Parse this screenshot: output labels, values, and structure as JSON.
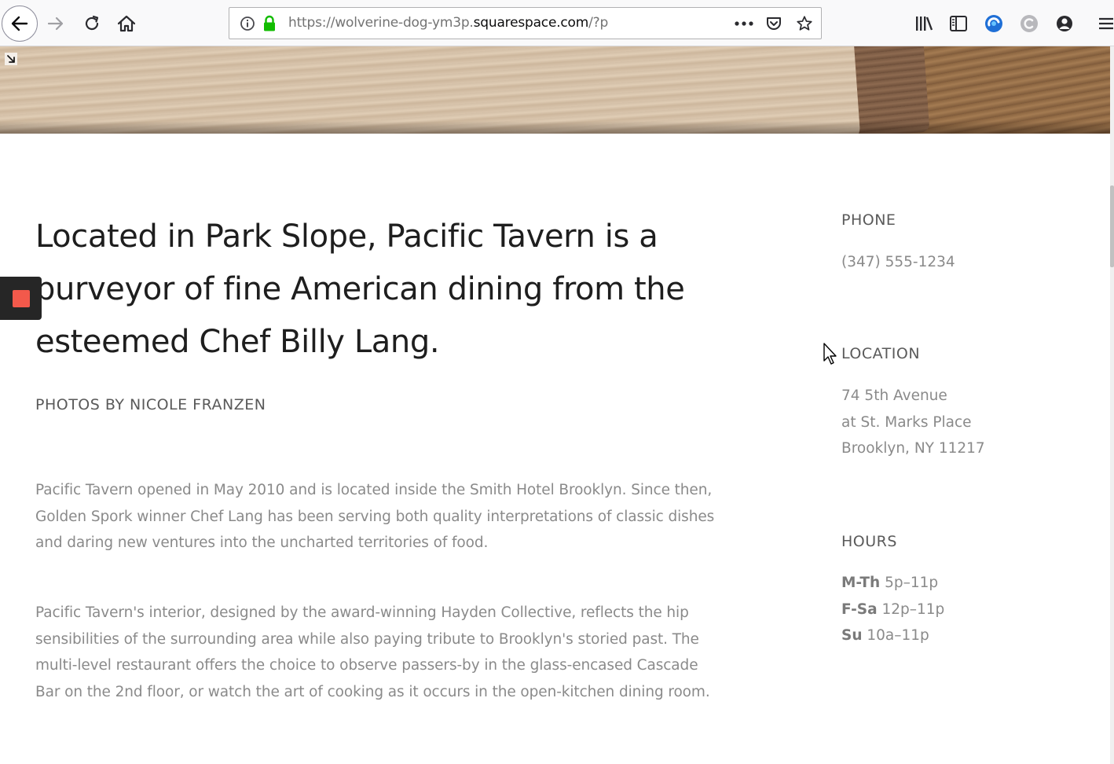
{
  "browser": {
    "url_prefix": "https://wolverine-dog-ym3p.",
    "url_domain": "squarespace.com",
    "url_suffix": "/?p",
    "icons": {
      "back": "back-arrow-icon",
      "forward": "forward-arrow-icon",
      "reload": "reload-icon",
      "home": "home-icon",
      "info": "info-icon",
      "lock": "lock-icon",
      "more": "more-dots-icon",
      "pocket": "pocket-icon",
      "bookmark": "star-icon",
      "library": "library-icon",
      "sidebar": "sidebar-icon",
      "ext1": "extension-blue-icon",
      "ext2": "extension-grey-icon",
      "account": "account-icon",
      "menu": "hamburger-menu-icon"
    },
    "accent_color": "#0a84ff",
    "lock_color": "#12bc00"
  },
  "page": {
    "headline": "Located in Park Slope, Pacific Tavern is a purveyor of fine American dining from the esteemed Chef Billy Lang.",
    "credit": "PHOTOS BY NICOLE FRANZEN",
    "paragraphs": [
      "Pacific Tavern opened in May 2010 and is located inside the Smith Hotel Brooklyn. Since then, Golden Spork winner Chef Lang has been serving both quality interpretations of classic dishes and daring new ventures into the uncharted territories of food.",
      "Pacific Tavern's interior, designed by the award-winning Hayden Collective, reflects the hip sensibilities of the surrounding area while also paying tribute to Brooklyn's storied past. The multi-level restaurant offers the choice to observe passers-by in the glass-encased Cascade Bar on the 2nd floor, or watch the art of cooking as it occurs in the open-kitchen dining room."
    ],
    "sidebar": {
      "phone_heading": "PHONE",
      "phone": "(347) 555-1234",
      "location_heading": "LOCATION",
      "address_line1": "74 5th Avenue",
      "address_line2": "at St. Marks Place",
      "address_line3": "Brooklyn, NY 11217",
      "hours_heading": "HOURS",
      "hours": [
        {
          "days": "M-Th",
          "time": "5p–11p"
        },
        {
          "days": "F-Sa",
          "time": "12p–11p"
        },
        {
          "days": "Su",
          "time": "10a–11p"
        }
      ]
    },
    "float_button_color": "#f2594b"
  }
}
